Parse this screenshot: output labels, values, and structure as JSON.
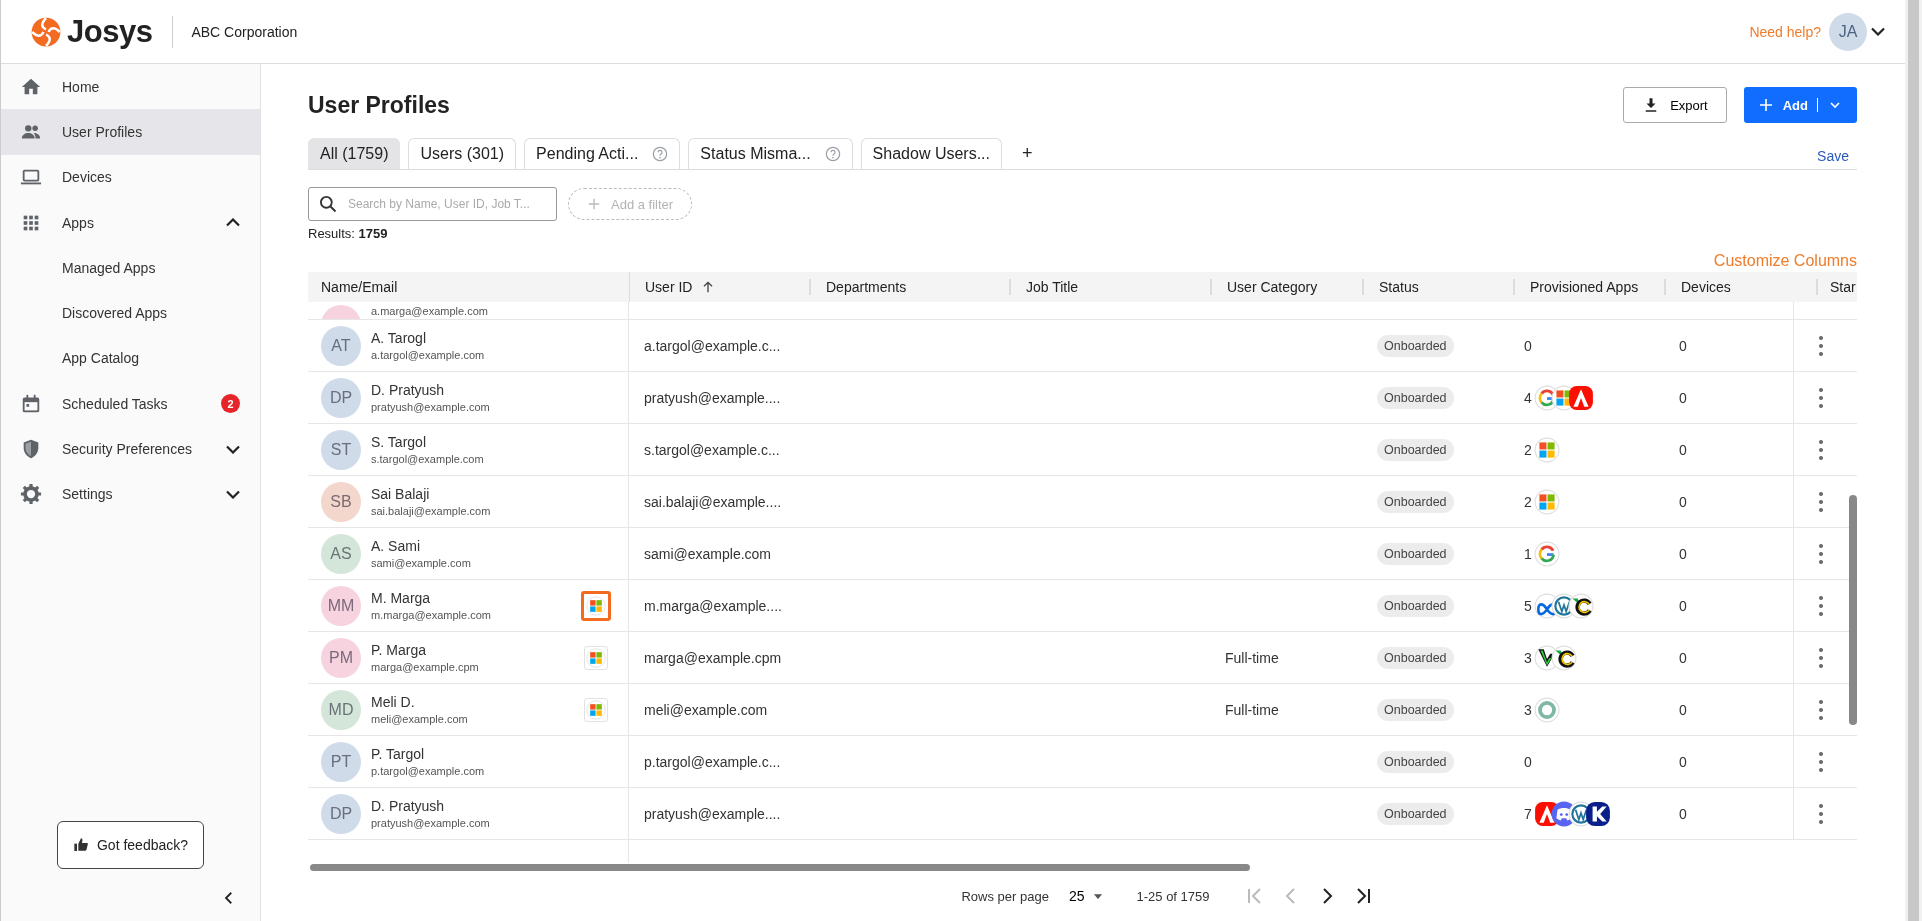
{
  "header": {
    "brand": "Josys",
    "company": "ABC Corporation",
    "help": "Need help?",
    "avatar": "JA"
  },
  "sidebar": {
    "items": [
      {
        "label": "Home",
        "selected": false
      },
      {
        "label": "User Profiles",
        "selected": true
      },
      {
        "label": "Devices",
        "selected": false
      },
      {
        "label": "Apps",
        "selected": false,
        "expanded": true,
        "children": [
          {
            "label": "Managed Apps",
            "selected": false
          },
          {
            "label": "Discovered Apps",
            "selected": false
          },
          {
            "label": "App Catalog",
            "selected": false
          }
        ]
      },
      {
        "label": "Scheduled Tasks",
        "selected": false,
        "badge": "2"
      },
      {
        "label": "Security Preferences",
        "selected": false,
        "expanded": false
      },
      {
        "label": "Settings",
        "selected": false,
        "expanded": false
      }
    ],
    "feedback": "Got feedback?"
  },
  "page": {
    "title": "User Profiles",
    "export": "Export",
    "add": "Add"
  },
  "tabs": [
    {
      "label": "All (1759)",
      "selected": true,
      "help": false
    },
    {
      "label": "Users (301)",
      "selected": false,
      "help": false
    },
    {
      "label": "Pending Acti...",
      "selected": false,
      "help": true
    },
    {
      "label": "Status Misma...",
      "selected": false,
      "help": true
    },
    {
      "label": "Shadow Users...",
      "selected": false,
      "help": false
    }
  ],
  "add_tab": "+",
  "save": "Save",
  "search": {
    "placeholder": "Search by Name, User ID, Job T..."
  },
  "filter": "Add a filter",
  "results": {
    "label": "Results:",
    "count": "1759"
  },
  "customize": "Customize Columns",
  "table": {
    "columns": [
      {
        "label": "Name/Email"
      },
      {
        "label": "User ID",
        "sorted": true
      },
      {
        "label": "Departments"
      },
      {
        "label": "Job Title"
      },
      {
        "label": "User Category"
      },
      {
        "label": "Status"
      },
      {
        "label": "Provisioned Apps"
      },
      {
        "label": "Devices"
      },
      {
        "label": "Star"
      }
    ],
    "rows": [
      {
        "kind": "partial",
        "color": "#f6d3df",
        "email": "a.marga@example.com"
      },
      {
        "kind": "full",
        "initials": "AT",
        "color": "#cfdbe9",
        "name": "A. Tarogl",
        "email": "a.targol@example.com",
        "user_id": "a.targol@example.c...",
        "status": "Onboarded",
        "apps_count": "0",
        "devices": "0"
      },
      {
        "kind": "full",
        "initials": "DP",
        "color": "#cfdbe9",
        "name": "D. Pratyush",
        "email": "pratyush@example.com",
        "user_id": "pratyush@example....",
        "status": "Onboarded",
        "apps_count": "4",
        "apps": [
          {
            "kind": "google"
          },
          {
            "kind": "microsoft"
          },
          {
            "kind": "adobe"
          }
        ],
        "devices": "0"
      },
      {
        "kind": "full",
        "initials": "ST",
        "color": "#cfdbe9",
        "name": "S. Targol",
        "email": "s.targol@example.com",
        "user_id": "s.targol@example.c...",
        "status": "Onboarded",
        "apps_count": "2",
        "apps": [
          {
            "kind": "microsoft"
          }
        ],
        "devices": "0"
      },
      {
        "kind": "full",
        "initials": "SB",
        "color": "#f3d6cc",
        "name": "Sai Balaji",
        "email": "sai.balaji@example.com",
        "user_id": "sai.balaji@example....",
        "status": "Onboarded",
        "apps_count": "2",
        "apps": [
          {
            "kind": "microsoft"
          }
        ],
        "devices": "0"
      },
      {
        "kind": "full",
        "initials": "AS",
        "color": "#d4e6d9",
        "name": "A. Sami",
        "email": "sami@example.com",
        "user_id": "sami@example.com",
        "status": "Onboarded",
        "apps_count": "1",
        "apps": [
          {
            "kind": "google"
          }
        ],
        "devices": "0"
      },
      {
        "kind": "full",
        "initials": "MM",
        "color": "#f6d3df",
        "name": "M. Marga",
        "email": "m.marga@example.com",
        "source": {
          "kind": "microsoft",
          "highlighted": true
        },
        "user_id": "m.marga@example....",
        "status": "Onboarded",
        "apps_count": "5",
        "apps": [
          {
            "kind": "meta"
          },
          {
            "kind": "wordpress"
          },
          {
            "kind": "c-mark"
          }
        ],
        "devices": "0"
      },
      {
        "kind": "full",
        "initials": "PM",
        "color": "#f6d3df",
        "name": "P. Marga",
        "email": "marga@example.cpm",
        "source": {
          "kind": "microsoft",
          "highlighted": false
        },
        "user_id": "marga@example.cpm",
        "category": "Full-time",
        "status": "Onboarded",
        "apps_count": "3",
        "apps": [
          {
            "kind": "v-mark"
          },
          {
            "kind": "c-mark"
          }
        ],
        "devices": "0"
      },
      {
        "kind": "full",
        "initials": "MD",
        "color": "#d4e6d9",
        "name": "Meli D.",
        "email": "meli@example.com",
        "source": {
          "kind": "microsoft",
          "highlighted": false
        },
        "user_id": "meli@example.com",
        "category": "Full-time",
        "status": "Onboarded",
        "apps_count": "3",
        "apps": [
          {
            "kind": "ring"
          }
        ],
        "devices": "0"
      },
      {
        "kind": "full",
        "initials": "PT",
        "color": "#cfdbe9",
        "name": "P. Targol",
        "email": "p.targol@example.com",
        "user_id": "p.targol@example.c...",
        "status": "Onboarded",
        "apps_count": "0",
        "devices": "0"
      },
      {
        "kind": "full",
        "initials": "DP",
        "color": "#cfdbe9",
        "name": "D. Pratyush",
        "email": "pratyush@example.com",
        "user_id": "pratyush@example....",
        "status": "Onboarded",
        "apps_count": "7",
        "apps": [
          {
            "kind": "adobe"
          },
          {
            "kind": "discord"
          },
          {
            "kind": "wordpress"
          },
          {
            "kind": "k-mark"
          }
        ],
        "devices": "0"
      }
    ]
  },
  "pagination": {
    "rows_label": "Rows per page",
    "rows_per_page": "25",
    "range": "1-25 of 1759"
  }
}
